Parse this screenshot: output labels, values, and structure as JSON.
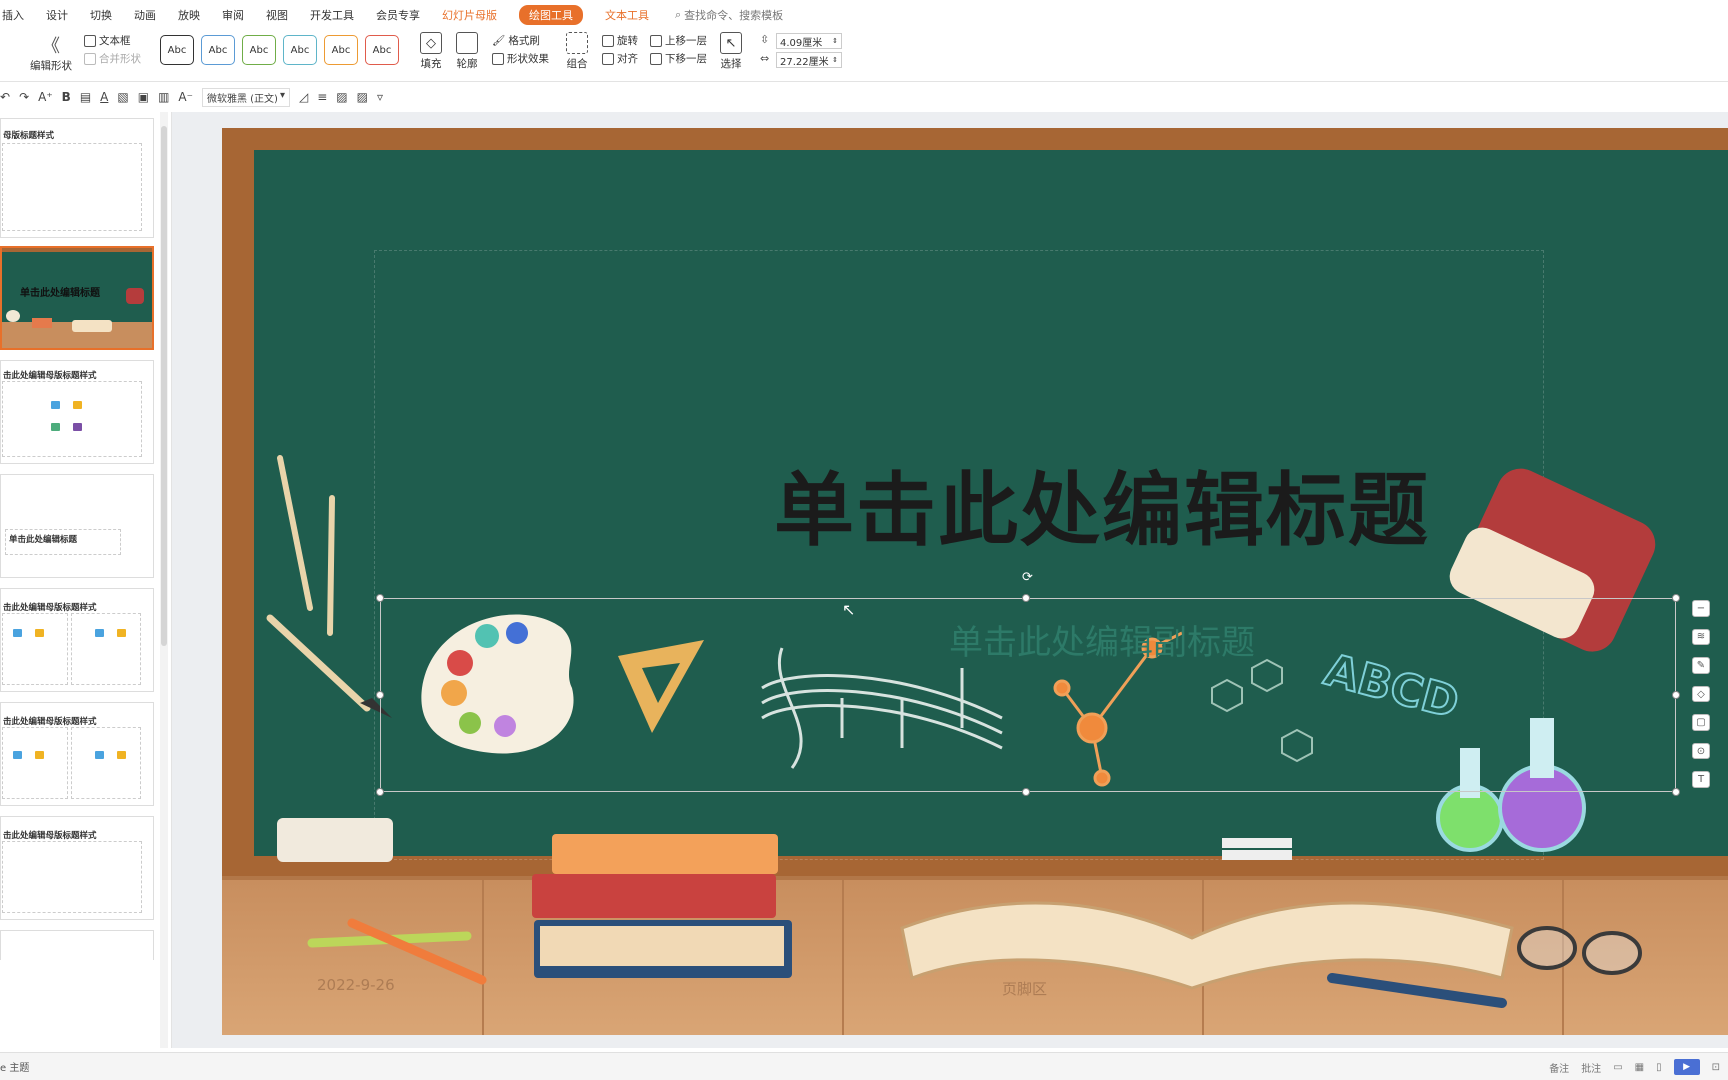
{
  "menubar": {
    "items": [
      "插入",
      "设计",
      "切换",
      "动画",
      "放映",
      "审阅",
      "视图",
      "开发工具",
      "会员专享"
    ],
    "context_tabs": [
      "幻灯片母版",
      "绘图工具",
      "文本工具"
    ],
    "active_context_tab": "绘图工具",
    "search_placeholder": "查找命令、搜索模板"
  },
  "ribbon": {
    "edit_shape": "编辑形状",
    "textbox": "文本框",
    "merge_shape": "合并形状",
    "style_samples": [
      "Abc",
      "Abc",
      "Abc",
      "Abc",
      "Abc",
      "Abc"
    ],
    "style_colors": [
      "#333333",
      "#5b9bd5",
      "#70ad47",
      "#5fb5c9",
      "#ed9b33",
      "#e05b4b"
    ],
    "fill": "填充",
    "outline": "轮廓",
    "format_painter": "格式刷",
    "shape_effect": "形状效果",
    "group": "组合",
    "rotate": "旋转",
    "align": "对齐",
    "bring_forward": "上移一层",
    "send_backward": "下移一层",
    "select": "选择",
    "height_value": "4.09厘米",
    "width_value": "27.22厘米"
  },
  "format_bar": {
    "font_name": "微软雅黑 (正文)"
  },
  "thumbnails": [
    {
      "title": "母版标题样式",
      "kind": "master"
    },
    {
      "title": "单击此处编辑标题",
      "kind": "title-slide"
    },
    {
      "title": "击此处编辑母版标题样式",
      "kind": "content"
    },
    {
      "title": "单击此处编辑标题",
      "kind": "section"
    },
    {
      "title": "击此处编辑母版标题样式",
      "kind": "two-content"
    },
    {
      "title": "击此处编辑母版标题样式",
      "kind": "comparison"
    },
    {
      "title": "击此处编辑母版标题样式",
      "kind": "title-only"
    }
  ],
  "slide": {
    "title": "单击此处编辑标题",
    "subtitle": "单击此处编辑副标题",
    "date": "2022-9-26",
    "footer": "页脚区",
    "abcd": "ABCD"
  },
  "statusbar": {
    "theme": "e 主题",
    "notes": "备注",
    "comments": "批注"
  }
}
